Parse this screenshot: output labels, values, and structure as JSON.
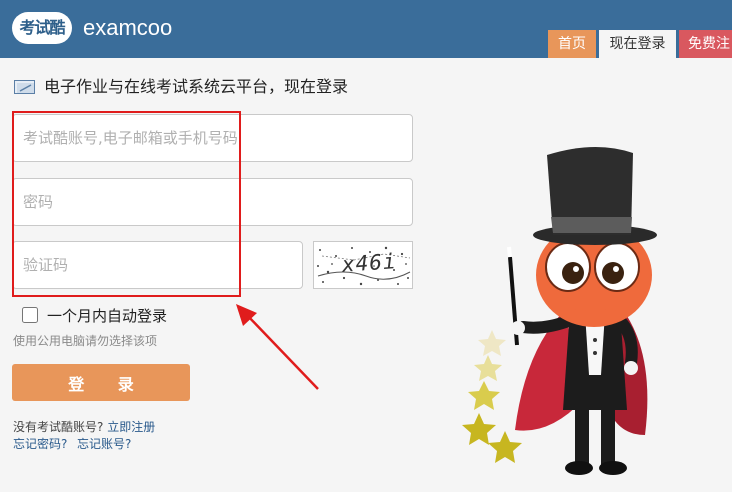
{
  "header": {
    "logo_text": "考试酷",
    "brand": "examcoo",
    "tabs": [
      {
        "label": "首页"
      },
      {
        "label": "现在登录"
      },
      {
        "label": "免费注"
      }
    ]
  },
  "main": {
    "headline": "电子作业与在线考试系统云平台，现在登录",
    "account_placeholder": "考试酷账号,电子邮箱或手机号码",
    "password_placeholder": "密码",
    "captcha_placeholder": "验证码",
    "captcha_text": "x46i",
    "remember_label": "一个月内自动登录",
    "hint": "使用公用电脑请勿选择该项",
    "login_button": "登 录",
    "no_account_text": "没有考试酷账号?",
    "register_link": "立即注册",
    "forgot_password": "忘记密码?",
    "forgot_account": "忘记账号?"
  },
  "colors": {
    "header_bg": "#3a6d9a",
    "accent_orange": "#e8965a",
    "register_red": "#d9585f",
    "annotation_red": "#e01c1c",
    "link_blue": "#2a5a8c"
  }
}
